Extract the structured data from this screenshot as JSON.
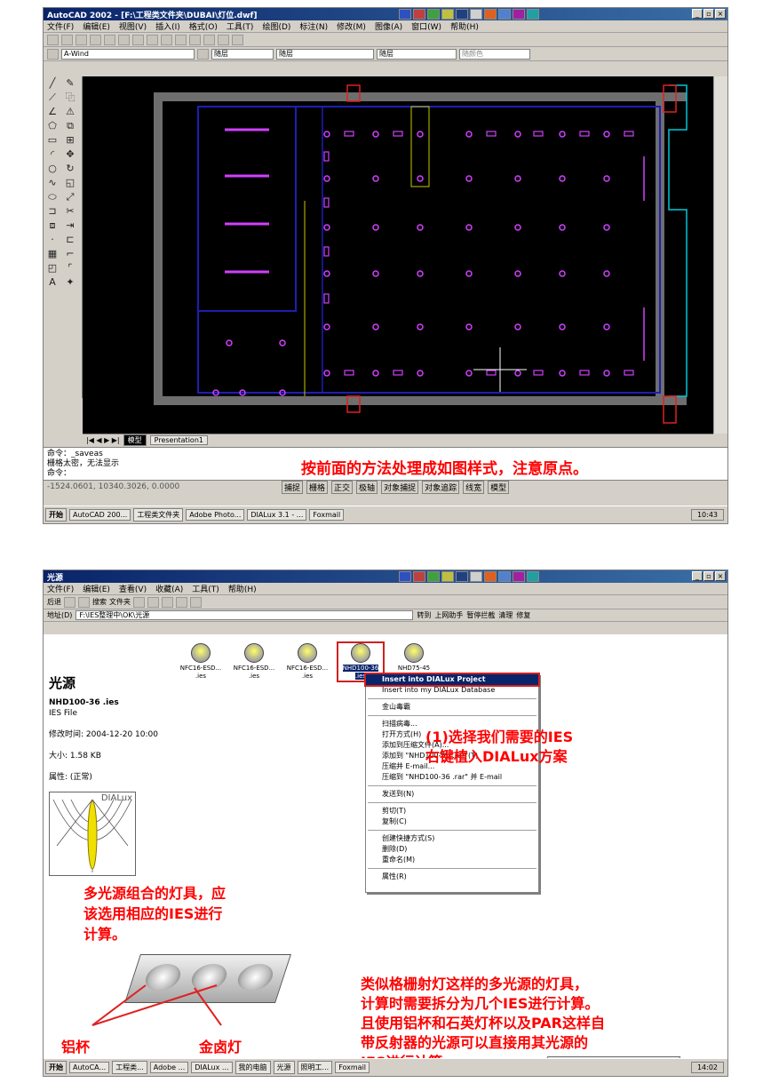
{
  "shot1": {
    "title": "AutoCAD 2002 - [F:\\工程类文件夹\\DUBAI\\灯位.dwf]",
    "menu": [
      "文件(F)",
      "编辑(E)",
      "视图(V)",
      "插入(I)",
      "格式(O)",
      "工具(T)",
      "绘图(D)",
      "标注(N)",
      "修改(M)",
      "图像(A)",
      "窗口(W)",
      "帮助(H)"
    ],
    "layer": "A-Wind",
    "layer_combo": "随层",
    "linetype": "随层",
    "lineweight": "随层",
    "color": "随颜色",
    "tabs": [
      "模型",
      "Presentation1"
    ],
    "command_lines": [
      "命令：_saveas",
      "栅格太密，无法显示",
      "命令："
    ],
    "annotation": "按前面的方法处理成如图样式，注意原点。",
    "coords": "-1524.0601, 10340.3026, 0.0000",
    "status_buttons": [
      "捕捉",
      "栅格",
      "正交",
      "极轴",
      "对象捕捉",
      "对象追踪",
      "线宽",
      "模型"
    ],
    "taskbar": {
      "start": "开始",
      "tasks": [
        "AutoCAD 200...",
        "工程类文件夹",
        "Adobe Photo...",
        "DIALux 3.1 - ...",
        "Foxmail"
      ],
      "clock": "10:43"
    }
  },
  "shot2": {
    "title": "光源",
    "menu": [
      "文件(F)",
      "编辑(E)",
      "查看(V)",
      "收藏(A)",
      "工具(T)",
      "帮助(H)"
    ],
    "toolbar": [
      "后退",
      "搜索",
      "文件夹"
    ],
    "address_label": "地址(D)",
    "address": "F:\\IES整理中\\OK\\光源",
    "go": "转到",
    "toolbar_right": [
      "上网助手",
      "暂停拦截",
      "清理",
      "修复"
    ],
    "folder_title": "光源",
    "file_name": "NHD100-36 .ies",
    "file_type": "IES File",
    "modified": "修改时间: 2004-12-20 10:00",
    "size": "大小: 1.58 KB",
    "attributes": "属性: (正常)",
    "dialux_label": "DIALux",
    "files": [
      "NFC16-ESD... .ies",
      "NFC16-ESD... .ies",
      "NFC16-ESD... .ies",
      "NHD100-36 .ies",
      "NHD75-45 .ies"
    ],
    "context_menu": [
      "Insert into DIALux Project",
      "Insert into my DIALux Database",
      "金山毒霸",
      "扫描病毒...",
      "打开方式(H)",
      "添加到压缩文件(A)...",
      "添加到 \"NHD100-36 .rar\"(T)",
      "压缩并 E-mail...",
      "压缩到 \"NHD100-36 .rar\" 并 E-mail",
      "发送到(N)",
      "剪切(T)",
      "复制(C)",
      "创建快捷方式(S)",
      "删除(D)",
      "重命名(M)",
      "属性(R)"
    ],
    "annotation_step": [
      "(1)选择我们需要的IES",
      "右键植入DIALux方案"
    ],
    "annotation_combo": [
      "多光源组合的灯具，应",
      "该选用相应的IES进行",
      "计算。"
    ],
    "annotation_multi": [
      "类似格栅射灯这样的多光源的灯具，",
      "计算时需要拆分为几个IES进行计算。",
      "且使用铝杯和石英灯杯以及PAR这样自",
      "带反射器的光源可以直接用其光源的",
      "IES进行计算。"
    ],
    "label_cup": "铝杯",
    "label_lamp": "金卤灯",
    "taskbar": {
      "start": "开始",
      "tasks": [
        "AutoCA...",
        "工程类...",
        "Adobe ...",
        "DIALux ...",
        "我的电脑",
        "光源",
        "照明工...",
        "Foxmail"
      ],
      "clock": "14:02"
    }
  },
  "colors": {
    "annotation": "#ff0000",
    "title_bar": "#0a246a",
    "cad_background": "#000000",
    "cad_wall": "#6e6e6e",
    "cad_blue": "#1e1eb4",
    "cad_magenta": "#d040ff",
    "cad_cyan": "#00c8d8",
    "cad_red": "#e02020",
    "cad_yellow": "#c8c800"
  }
}
